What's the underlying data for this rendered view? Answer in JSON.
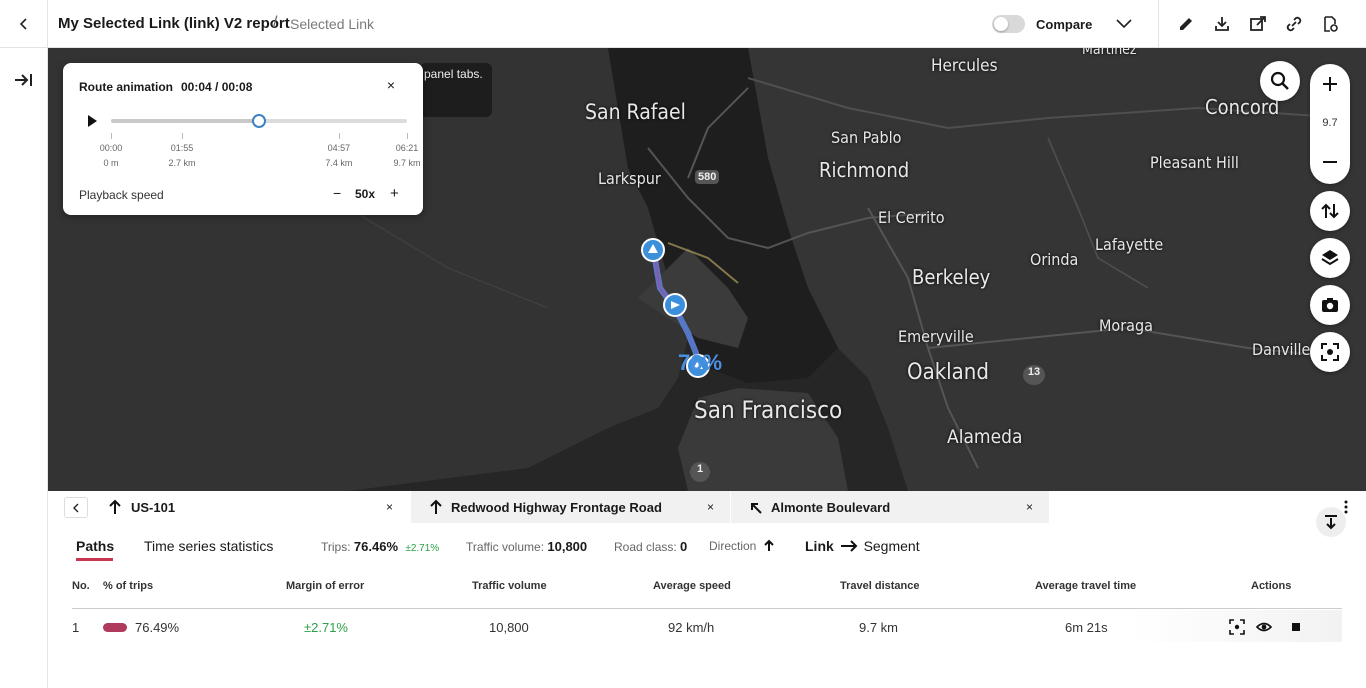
{
  "header": {
    "title": "My Selected Link (link) V2 report",
    "separator": "/",
    "breadcrumb": "Selected Link",
    "compare_label": "Compare"
  },
  "map": {
    "places": [
      {
        "name": "Hercules"
      },
      {
        "name": "Martinez"
      },
      {
        "name": "San Rafael"
      },
      {
        "name": "Concord"
      },
      {
        "name": "San Pablo"
      },
      {
        "name": "Richmond"
      },
      {
        "name": "Pleasant Hill"
      },
      {
        "name": "Larkspur"
      },
      {
        "name": "El Cerrito"
      },
      {
        "name": "Lafayette"
      },
      {
        "name": "Orinda"
      },
      {
        "name": "Berkeley"
      },
      {
        "name": "Moraga"
      },
      {
        "name": "Emeryville"
      },
      {
        "name": "Danville"
      },
      {
        "name": "Oakland"
      },
      {
        "name": "San Francisco"
      },
      {
        "name": "Alameda"
      }
    ],
    "shields": [
      "580",
      "13",
      "1"
    ],
    "percent_label": "76%",
    "hint_text": "panel tabs.",
    "zoom_level": "9.7"
  },
  "animation": {
    "title": "Route animation",
    "time": "00:04 / 00:08",
    "close": "×",
    "progress": 0.5,
    "ticks": [
      {
        "time": "00:00",
        "dist": "0 m",
        "pos": 0.0
      },
      {
        "time": "01:55",
        "dist": "2.7 km",
        "pos": 0.24
      },
      {
        "time": "04:57",
        "dist": "7.4 km",
        "pos": 0.77
      },
      {
        "time": "06:21",
        "dist": "9.7 km",
        "pos": 1.0
      }
    ],
    "speed_label": "Playback speed",
    "speed_minus": "−",
    "speed_value": "50x",
    "speed_plus": "+"
  },
  "links": [
    {
      "name": "US-101",
      "close": "×"
    },
    {
      "name": "Redwood Highway Frontage Road",
      "close": "×"
    },
    {
      "name": "Almonte Boulevard",
      "close": "×"
    }
  ],
  "panel": {
    "tabs": [
      "Paths",
      "Time series statistics"
    ],
    "trips_label": "Trips:",
    "trips_value": "76.46%",
    "trips_margin": "±2.71%",
    "volume_label": "Traffic volume:",
    "volume_value": "10,800",
    "road_class_label": "Road class:",
    "road_class_value": "0",
    "direction_label": "Direction",
    "mode_from": "Link",
    "mode_to": "Segment"
  },
  "table": {
    "columns": [
      "No.",
      "% of trips",
      "Margin of error",
      "Traffic volume",
      "Average speed",
      "Travel distance",
      "Average travel time",
      "Actions"
    ],
    "rows": [
      {
        "no": "1",
        "pct": "76.49%",
        "margin": "±2.71%",
        "volume": "10,800",
        "speed": "92 km/h",
        "distance": "9.7 km",
        "time": "6m 21s",
        "color": "#b03a5b"
      }
    ]
  },
  "colors": {
    "accent": "#c8374f",
    "route": "#5b7fd6",
    "marker": "#3b8fdb",
    "positive": "#2aa14a"
  }
}
